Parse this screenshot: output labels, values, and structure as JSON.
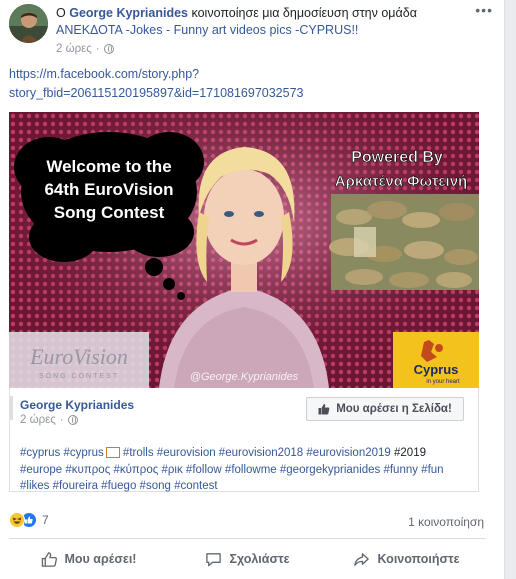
{
  "header": {
    "prefix": "Ο",
    "author": "George Kyprianides",
    "action_text": "κοινοποίησε μια δημοσίευση στην ομάδα",
    "group": "ΑΝΕΚΔΟΤΑ -Jokes - Funny art videos pics -CYPRUS!!",
    "time": "2 ώρες",
    "more": "•••"
  },
  "story_link": "https://m.facebook.com/story.php?story_fbid=206115120195897&id=171081697032573",
  "media": {
    "bubble_text_1": "Welcome to the",
    "bubble_text_2": "64th EuroVision",
    "bubble_text_3": "Song Contest",
    "powered_1": "Powered By",
    "powered_2": "Αρκατένα Φωτεινή",
    "watermark": "@George.Kyprianides",
    "eurovision_logo": "EuroVision",
    "eurovision_sub": "SONG CONTEST",
    "cyprus_logo": "Cyprus",
    "cyprus_tagline": "in your heart"
  },
  "card": {
    "name": "George Kyprianides",
    "time": "2 ώρες",
    "like_page": "Μου αρέσει η Σελίδα!",
    "hashtags_line1": "#cyprus #cyprus",
    "hashtags_line1b": " #trolls #eurovision #eurovision2018 #eurovision2019",
    "hashtags_plain": " #2019",
    "hashtags_line2": "#europe #κυπρος #κύπρος #ρικ #follow #followme #georgekyprianides #funny #fun",
    "hashtags_line3": "#likes #foureira #fuego #song #contest"
  },
  "stats": {
    "reaction_count": "7",
    "shares": "1 κοινοποίηση"
  },
  "actions": {
    "like": "Μου αρέσει!",
    "comment": "Σχολιάστε",
    "share": "Κοινοποιήστε"
  },
  "colors": {
    "link": "#365899",
    "meta": "#90949c",
    "accent_like": "#2078f4"
  }
}
